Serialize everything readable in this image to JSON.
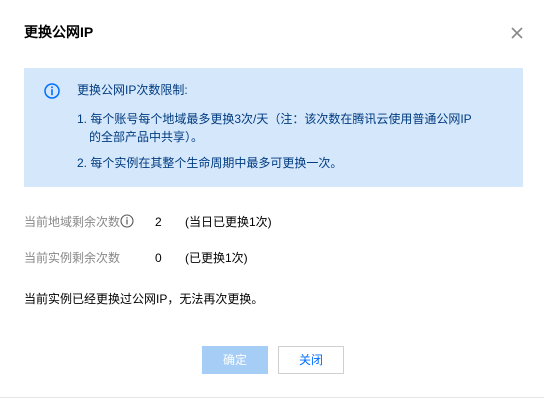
{
  "dialog": {
    "title": "更换公网IP",
    "close_icon": "close-icon"
  },
  "info": {
    "icon": "info-icon",
    "heading": "更换公网IP次数限制:",
    "item1_line1": "1. 每个账号每个地域最多更换3次/天（注：该次数在腾讯云使用普通公网IP",
    "item1_line2": "的全部产品中共享）。",
    "item2": "2. 每个实例在其整个生命周期中最多可更换一次。"
  },
  "stats": {
    "region_label": "当前地域剩余次数",
    "region_value": "2",
    "region_note": "(当日已更换1次)",
    "instance_label": "当前实例剩余次数",
    "instance_value": "0",
    "instance_note": "(已更换1次)"
  },
  "notice": "当前实例已经更换过公网IP，无法再次更换。",
  "buttons": {
    "confirm": "确定",
    "close": "关闭"
  },
  "colors": {
    "info_bg": "#d5e7fb",
    "info_text": "#003b80",
    "primary_disabled": "#a5cdf5",
    "link_blue": "#006eff",
    "label_gray": "#888888"
  }
}
